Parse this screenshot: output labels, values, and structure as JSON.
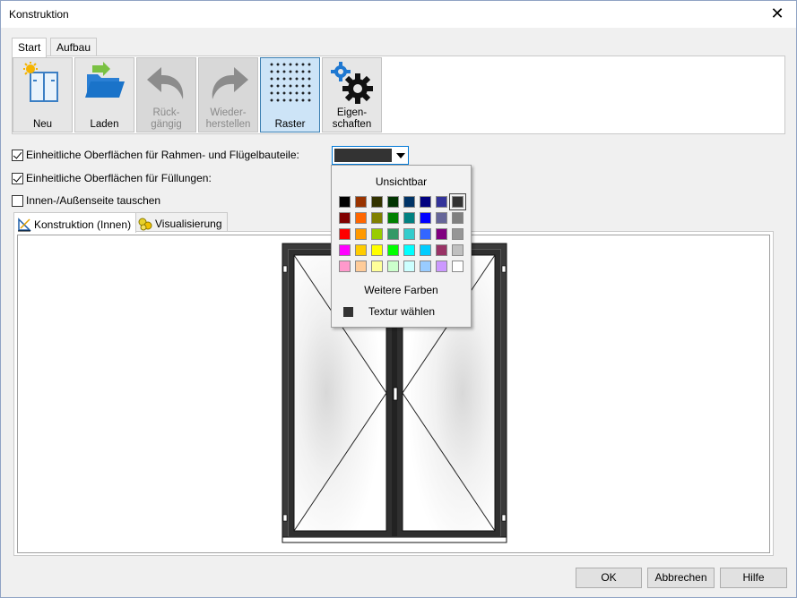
{
  "window": {
    "title": "Konstruktion",
    "close": "✕"
  },
  "tabs_top": [
    {
      "label": "Start",
      "active": true
    },
    {
      "label": "Aufbau",
      "active": false
    }
  ],
  "ribbon": {
    "new": "Neu",
    "load": "Laden",
    "undo": "Rück-\ngängig",
    "redo": "Wieder-\nherstellen",
    "grid": "Raster",
    "properties": "Eigen-\nschaften"
  },
  "options": {
    "uniform_frame": {
      "label": "Einheitliche Oberflächen für Rahmen- und Flügelbauteile:",
      "checked": true
    },
    "uniform_fill": {
      "label": "Einheitliche Oberflächen für Füllungen:",
      "checked": true
    },
    "swap_sides": {
      "label": "Innen-/Außenseite tauschen",
      "checked": false
    }
  },
  "color_select": {
    "value": "#333333"
  },
  "tabs_view": [
    {
      "label": "Konstruktion (Innen)",
      "active": true
    },
    {
      "label": "Visualisierung",
      "active": false
    }
  ],
  "color_dropdown": {
    "invisible_label": "Unsichtbar",
    "more_colors_label": "Weitere Farben",
    "texture_label": "Textur wählen",
    "selected_color": "#333333",
    "palette": [
      [
        "#000000",
        "#993300",
        "#333300",
        "#003300",
        "#003366",
        "#000080",
        "#333399",
        "#333333"
      ],
      [
        "#800000",
        "#ff6600",
        "#808000",
        "#008000",
        "#008080",
        "#0000ff",
        "#666699",
        "#808080"
      ],
      [
        "#ff0000",
        "#ff9900",
        "#99cc00",
        "#339966",
        "#33cccc",
        "#3366ff",
        "#800080",
        "#969696"
      ],
      [
        "#ff00ff",
        "#ffcc00",
        "#ffff00",
        "#00ff00",
        "#00ffff",
        "#00ccff",
        "#993366",
        "#c0c0c0"
      ],
      [
        "#ff99cc",
        "#ffcc99",
        "#ffff99",
        "#ccffcc",
        "#ccffff",
        "#99ccff",
        "#cc99ff",
        "#ffffff"
      ]
    ]
  },
  "buttons": {
    "ok": "OK",
    "cancel": "Abbrechen",
    "help": "Hilfe"
  }
}
